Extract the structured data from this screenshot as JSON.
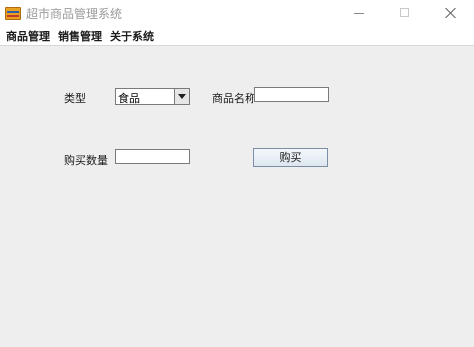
{
  "window": {
    "title": "超市商品管理系统"
  },
  "menubar": {
    "items": [
      {
        "label": "商品管理"
      },
      {
        "label": "销售管理"
      },
      {
        "label": "关于系统"
      }
    ]
  },
  "form": {
    "type_label": "类型",
    "type_value": "食品",
    "name_label": "商品名称",
    "name_value": "",
    "quantity_label": "购买数量",
    "quantity_value": "",
    "buy_button": "购买"
  },
  "colors": {
    "content_background": "#eeeeee",
    "button_border": "#7a8fa6"
  }
}
